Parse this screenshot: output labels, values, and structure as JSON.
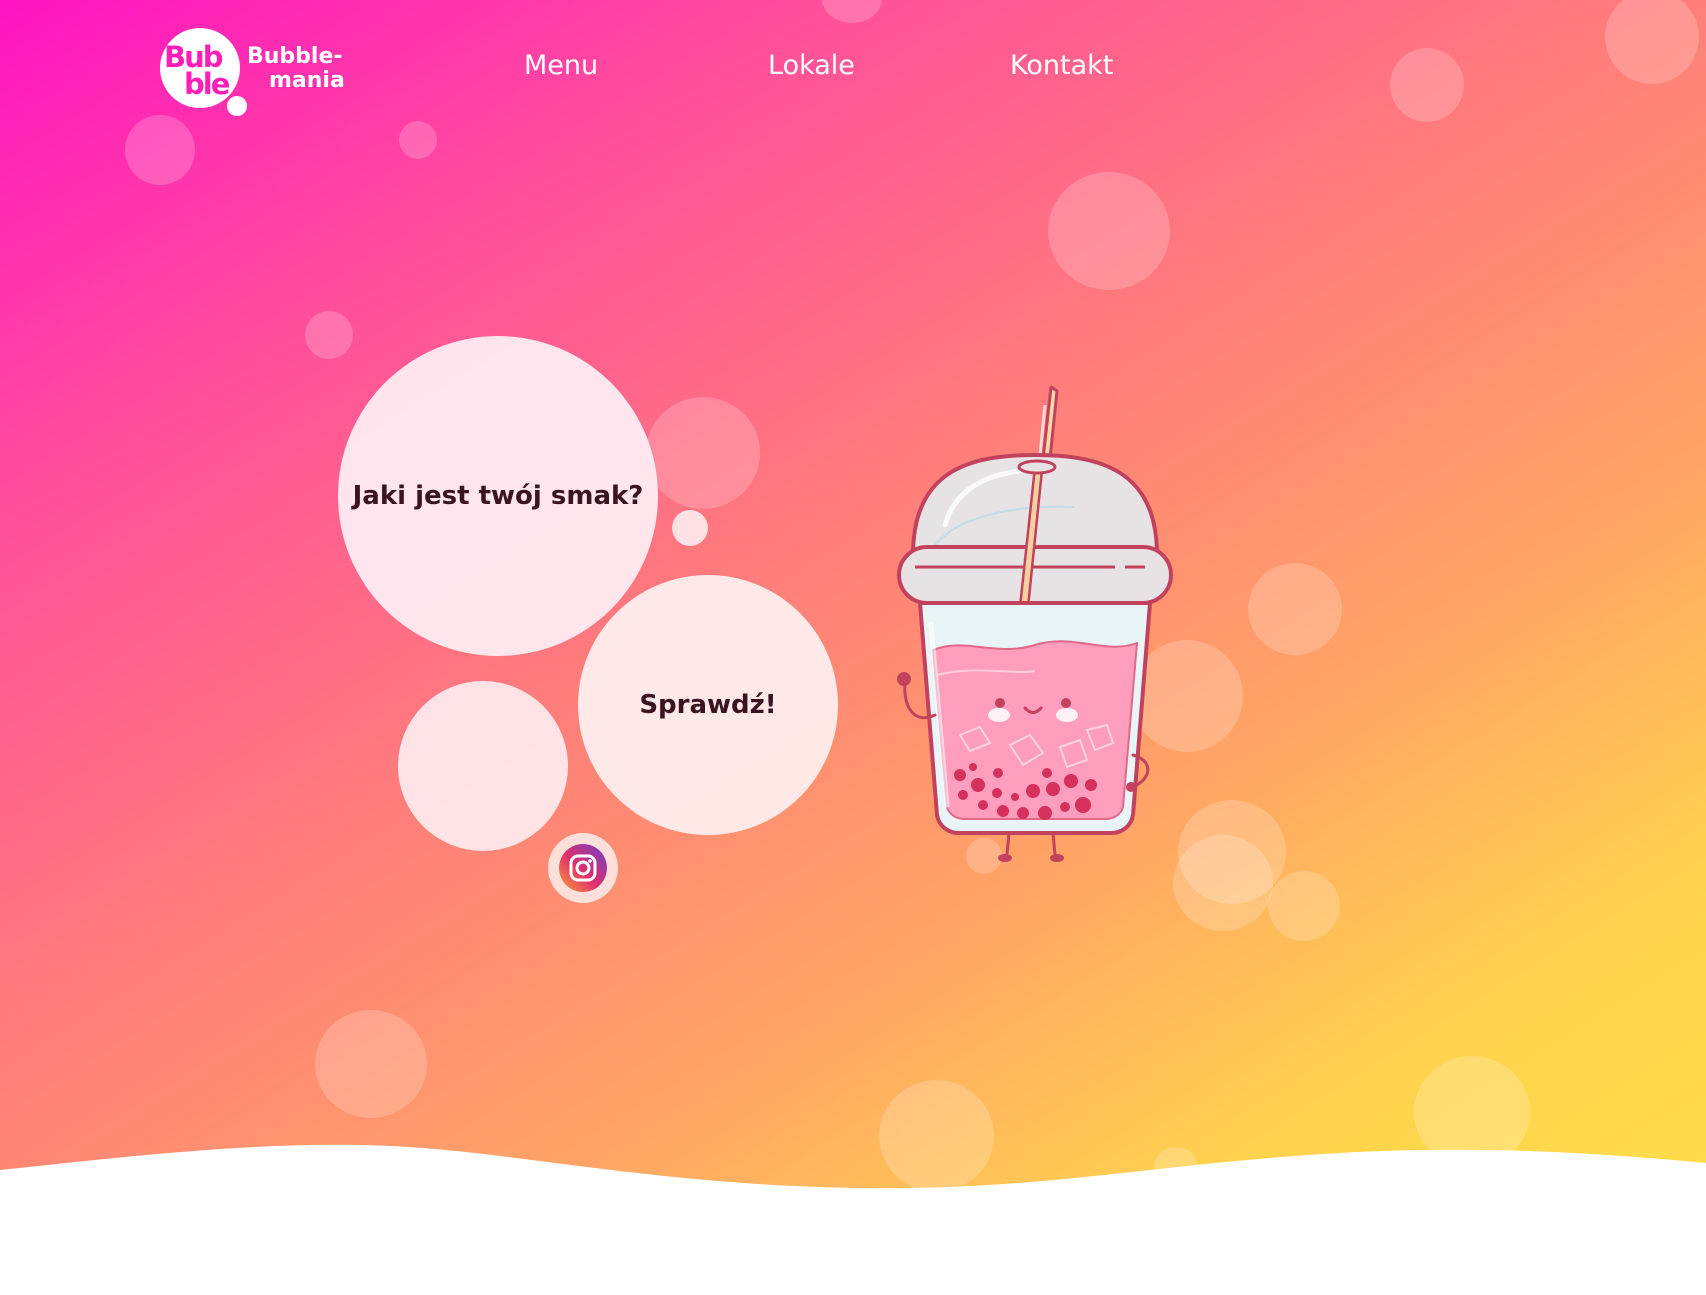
{
  "header": {
    "logo": {
      "mark_line1": "Bub",
      "mark_line2": "ble",
      "name_line1": "Bubble-",
      "name_line2": "mania"
    },
    "nav": {
      "menu": "Menu",
      "lokale": "Lokale",
      "kontakt": "Kontakt"
    }
  },
  "hero": {
    "question": "Jaki jest twój smak?",
    "cta": "Sprawdź!",
    "instagram_icon": "instagram-icon",
    "mascot": "bubble-tea-mascot"
  },
  "colors": {
    "gradient_start": "#ff14c2",
    "gradient_mid": "#ff7e7a",
    "gradient_end": "#ffe047",
    "logo_accent": "#ff1fb6",
    "text_dark": "#3a1420"
  }
}
